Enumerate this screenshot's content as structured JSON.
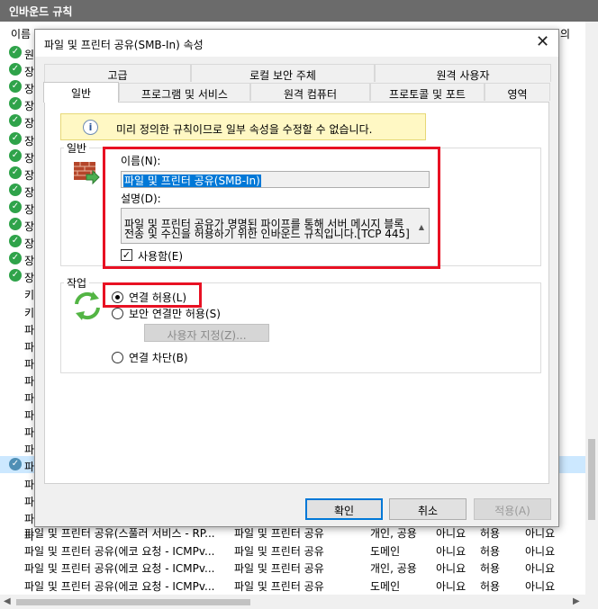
{
  "background": {
    "title": "인바운드 규칙",
    "header_name": "이름",
    "header_right": "의",
    "rows": [
      {
        "name": "원",
        "icon": "check"
      },
      {
        "name": "장",
        "icon": "check"
      },
      {
        "name": "장",
        "icon": "check"
      },
      {
        "name": "장",
        "icon": "check"
      },
      {
        "name": "장",
        "icon": "check"
      },
      {
        "name": "장",
        "icon": "check"
      },
      {
        "name": "장",
        "icon": "check"
      },
      {
        "name": "장",
        "icon": "check"
      },
      {
        "name": "장",
        "icon": "check"
      },
      {
        "name": "장",
        "icon": "check"
      },
      {
        "name": "장",
        "icon": "check"
      },
      {
        "name": "장",
        "icon": "check"
      },
      {
        "name": "장",
        "icon": "check"
      },
      {
        "name": "장",
        "icon": "check"
      },
      {
        "name": "키",
        "icon": ""
      },
      {
        "name": "키",
        "icon": ""
      },
      {
        "name": "파",
        "icon": ""
      },
      {
        "name": "파",
        "icon": ""
      },
      {
        "name": "파",
        "icon": ""
      },
      {
        "name": "파",
        "icon": ""
      },
      {
        "name": "파",
        "icon": ""
      },
      {
        "name": "파",
        "icon": ""
      },
      {
        "name": "파",
        "icon": ""
      },
      {
        "name": "파",
        "icon": ""
      },
      {
        "name": "파",
        "icon": "check-blue"
      },
      {
        "name": "파",
        "icon": ""
      },
      {
        "name": "파",
        "icon": ""
      },
      {
        "name": "파",
        "icon": ""
      },
      {
        "name": "파",
        "icon": ""
      }
    ],
    "bottom_rows": [
      {
        "name": "파일 및 프린터 공유(스풀러 서비스 - RP...",
        "group": "파일 및 프린터 공유",
        "profile": "개인, 공용",
        "c4": "아니요",
        "c5": "허용",
        "c6": "아니요"
      },
      {
        "name": "파일 및 프린터 공유(에코 요청 - ICMPv...",
        "group": "파일 및 프린터 공유",
        "profile": "도메인",
        "c4": "아니요",
        "c5": "허용",
        "c6": "아니요"
      },
      {
        "name": "파일 및 프린터 공유(에코 요청 - ICMPv...",
        "group": "파일 및 프린터 공유",
        "profile": "개인, 공용",
        "c4": "아니요",
        "c5": "허용",
        "c6": "아니요"
      },
      {
        "name": "파일 및 프린터 공유(에코 요청 - ICMPv...",
        "group": "파일 및 프린터 공유",
        "profile": "도메인",
        "c4": "아니요",
        "c5": "허용",
        "c6": "아니요"
      }
    ]
  },
  "dialog": {
    "title": "파일 및 프린터 공유(SMB-In) 속성",
    "close": "✕",
    "tabs_top": [
      "고급",
      "로컬 보안 주체",
      "원격 사용자"
    ],
    "tabs_bottom": [
      "일반",
      "프로그램 및 서비스",
      "원격 컴퓨터",
      "프로토콜 및 포트",
      "영역"
    ],
    "info_text": "미리 정의한 규칙이므로 일부 속성을 수정할 수 없습니다.",
    "general_group": "일반",
    "name_label": "이름(N):",
    "name_value": "파일 및 프린터 공유(SMB-In)",
    "desc_label": "설명(D):",
    "desc_value": "파일 및 프린터 공유가 명명된 파이프를 통해 서버 메시지 블록 전송 및 수신을 허용하기 위한 인바운드 규칙입니다.[TCP 445]",
    "enabled_label": "사용함(E)",
    "enabled_checked": true,
    "action_group": "작업",
    "radio_allow": "연결 허용(L)",
    "radio_secure": "보안 연결만 허용(S)",
    "custom_button": "사용자 지정(Z)...",
    "radio_block": "연결 차단(B)",
    "ok": "확인",
    "cancel": "취소",
    "apply": "적용(A)"
  }
}
